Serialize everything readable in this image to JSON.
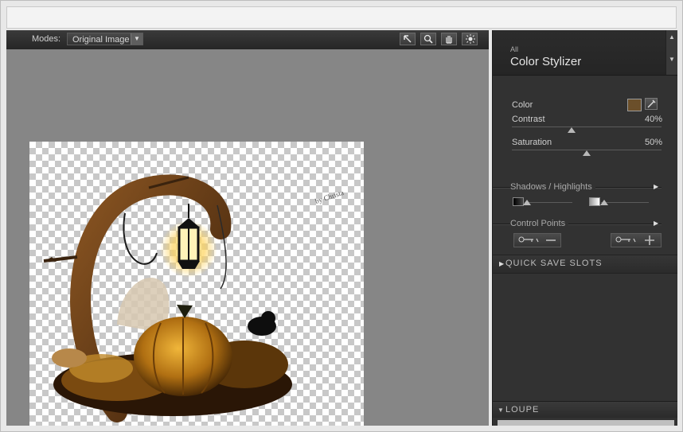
{
  "toolbar": {
    "modes_label": "Modes:",
    "mode_value": "Original Image",
    "tools": [
      "pointer-icon",
      "zoom-icon",
      "hand-icon",
      "preview-light-icon"
    ]
  },
  "image": {
    "watermark": "by Christa"
  },
  "panel": {
    "category": "All",
    "title": "Color Stylizer",
    "color_label": "Color",
    "color_swatch": "#6b4f2a",
    "contrast_label": "Contrast",
    "contrast_value": "40%",
    "contrast_level": 0.4,
    "saturation_label": "Saturation",
    "saturation_value": "50%",
    "saturation_level": 0.5,
    "shadows_label": "Shadows / Highlights",
    "control_points_label": "Control Points",
    "quick_save_label": "QUICK SAVE SLOTS",
    "loupe_label": "LOUPE"
  },
  "colors": {
    "panel_bg": "#323232",
    "canvas_bg": "#868686",
    "accent_swatch": "#6b4f2a"
  }
}
